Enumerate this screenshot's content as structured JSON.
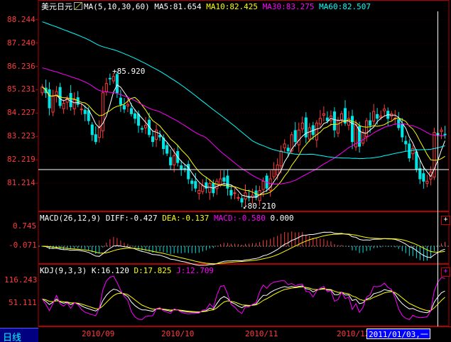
{
  "instrument": "美元日元",
  "colors": {
    "up": "#ff3b3b",
    "down": "#00e5e5",
    "frame": "#b40000",
    "axis_text": "#ff3b3b",
    "ma5": "#ffffff",
    "ma10": "#ffff00",
    "ma30": "#ff00ff",
    "ma60": "#00ffff",
    "diff": "#ffffff",
    "dea": "#ffff00",
    "macd": "#ff00ff",
    "crosshair": "#ffffff"
  },
  "main": {
    "indicator_label": "MA(5,10,30,60)",
    "ma5_label": "MA5:81.654",
    "ma10_label": "MA10:82.425",
    "ma30_label": "MA30:83.275",
    "ma60_label": "MA60:82.507",
    "yticks": [
      "88.244",
      "87.240",
      "86.236",
      "85.231",
      "84.227",
      "83.223",
      "82.219",
      "81.214"
    ],
    "high_marker": "85.920",
    "low_marker": "80.210",
    "crosshair_value": 81.8
  },
  "macd_panel": {
    "label": "MACD(26,12,9)",
    "diff_label": "DIFF:-0.427",
    "dea_label": "DEA:-0.137",
    "macd_label": "MACD:-0.580",
    "extra_label": "0.000",
    "yticks": [
      "0.745",
      "-0.071"
    ],
    "button": "+"
  },
  "kdj_panel": {
    "label": "KDJ(9,3,3)",
    "k_label": "K:16.120",
    "d_label": "D:17.825",
    "j_label": "J:12.709",
    "yticks": [
      "116.243",
      "51.111"
    ],
    "button": "+"
  },
  "footer": {
    "period_tab": "日线",
    "dates": [
      "2010/09",
      "2010/10",
      "2010/11",
      "2010/12"
    ],
    "cursor_date": "2011/01/03,一"
  },
  "chart_data": {
    "type": "candlestick",
    "ylim": [
      80.0,
      88.6
    ],
    "close": [
      85.35,
      85.1,
      84.45,
      84.95,
      85.15,
      84.55,
      84.65,
      84.85,
      84.5,
      84.8,
      84.6,
      84.4,
      84.2,
      83.9,
      83.3,
      83.0,
      83.6,
      85.1,
      85.5,
      85.7,
      85.8,
      85.1,
      84.6,
      84.4,
      84.6,
      84.2,
      84.0,
      83.7,
      83.55,
      83.7,
      83.3,
      83.0,
      83.5,
      83.2,
      82.7,
      82.5,
      82.0,
      82.4,
      82.1,
      81.8,
      81.8,
      81.4,
      81.2,
      81.0,
      80.9,
      81.1,
      81.0,
      81.2,
      80.8,
      81.3,
      81.4,
      81.3,
      81.0,
      80.7,
      80.8,
      80.6,
      80.4,
      80.8,
      80.6,
      80.7,
      80.6,
      80.9,
      81.3,
      81.0,
      81.4,
      81.8,
      82.0,
      82.6,
      82.9,
      82.6,
      83.3,
      83.0,
      83.5,
      83.8,
      83.2,
      83.6,
      83.3,
      83.8,
      84.0,
      84.2,
      83.9,
      84.1,
      83.5,
      83.9,
      84.2,
      83.8,
      84.0,
      83.0,
      83.7,
      82.8,
      83.4,
      83.9,
      83.7,
      84.3,
      84.0,
      84.1,
      84.4,
      84.0,
      84.2,
      84.0,
      83.6,
      83.2,
      82.9,
      82.3,
      82.7,
      81.8,
      81.4,
      81.3,
      81.3,
      81.7,
      83.4,
      83.3,
      83.5,
      83.3
    ],
    "ma60_start": 88.2,
    "indicators_shown": [
      "MA5",
      "MA10",
      "MA30",
      "MA60",
      "MACD",
      "KDJ"
    ]
  }
}
